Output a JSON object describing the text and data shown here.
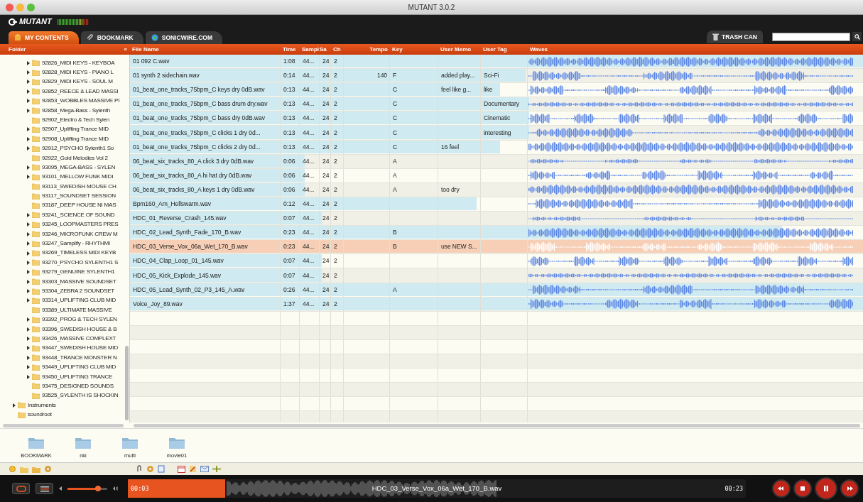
{
  "window": {
    "title": "MUTANT 3.0.2"
  },
  "header": {
    "logo": "MUTANT"
  },
  "tabs": [
    {
      "label": "MY CONTENTS",
      "selected": true
    },
    {
      "label": "BOOKMARK",
      "selected": false
    },
    {
      "label": "SONICWIRE.COM",
      "selected": false
    }
  ],
  "trash_button": "TRASH CAN",
  "folder_panel": {
    "title": "Folder",
    "collapse": "«",
    "tree": [
      {
        "children": [
          {
            "label": "92826_MIDI KEYS - KEYBOA",
            "expandable": true
          },
          {
            "label": "92828_MIDI KEYS - PIANO L",
            "expandable": true
          },
          {
            "label": "92829_MIDI KEYS - SOUL M",
            "expandable": true
          },
          {
            "label": "92852_REECE & LEAD MASSI",
            "expandable": true
          },
          {
            "label": "92853_WOBBLES MASSIVE PI",
            "expandable": true
          },
          {
            "label": "92858_Mega-Bass - Sylenth",
            "expandable": true
          },
          {
            "label": "92902_Electro & Tech Sylen",
            "expandable": false
          },
          {
            "label": "92907_Uplifting Trance MID",
            "expandable": true
          },
          {
            "label": "92908_Uplifting Trance MID",
            "expandable": true
          },
          {
            "label": "92912_PSYCHO Sylenth1 So",
            "expandable": true
          },
          {
            "label": "92922_Gold Melodies Vol 2",
            "expandable": false
          },
          {
            "label": "93095_MEGA-BASS - SYLEN",
            "expandable": true
          },
          {
            "label": "93101_MELLOW FUNK MIDI",
            "expandable": true
          },
          {
            "label": "93113_SWEDISH MOUSE CH",
            "expandable": false
          },
          {
            "label": "93117_SOUNDSET SESSION",
            "expandable": false
          },
          {
            "label": "93187_DEEP HOUSE NI MAS",
            "expandable": false
          },
          {
            "label": "93241_SCIENCE OF SOUND",
            "expandable": true
          },
          {
            "label": "93245_LOOPMASTERS PRES",
            "expandable": true
          },
          {
            "label": "93246_MICROFUNK CREW M",
            "expandable": true
          },
          {
            "label": "93247_Samplify - RHYTHMI",
            "expandable": true
          },
          {
            "label": "93269_TIMELESS MIDI KEYB",
            "expandable": true
          },
          {
            "label": "93270_PSYCHO SYLENTH1 S",
            "expandable": true
          },
          {
            "label": "93279_GENUINE SYLENTH1",
            "expandable": true
          },
          {
            "label": "93303_MASSIVE SOUNDSET",
            "expandable": true
          },
          {
            "label": "93304_ZEBRA 2 SOUNDSET",
            "expandable": true
          },
          {
            "label": "93314_UPLIFTING CLUB MID",
            "expandable": true
          },
          {
            "label": "93389_ULTIMATE MASSIVE",
            "expandable": false
          },
          {
            "label": "93392_PROG & TECH SYLEN",
            "expandable": true
          },
          {
            "label": "93396_SWEDISH HOUSE & B",
            "expandable": true
          },
          {
            "label": "93426_MASSIVE COMPLEXT",
            "expandable": true
          },
          {
            "label": "93447_SWEDISH HOUSE MID",
            "expandable": true
          },
          {
            "label": "93448_TRANCE MONSTER N",
            "expandable": true
          },
          {
            "label": "93449_UPLIFTING CLUB MID",
            "expandable": true
          },
          {
            "label": "93450_UPLIFTING TRANCE",
            "expandable": true
          },
          {
            "label": "93475_DESIGNED SOUNDS",
            "expandable": false
          },
          {
            "label": "93525_SYLENTH IS SHOCKIN",
            "expandable": false
          }
        ]
      },
      {
        "label": "Instruments",
        "expandable": true
      },
      {
        "label": "soundroot",
        "expandable": false
      }
    ]
  },
  "table": {
    "columns": [
      "File Name",
      "Time",
      "Sampl",
      "Sa",
      "Ch",
      "Tempo",
      "Key",
      "User Memo",
      "User Tag",
      "Waves"
    ],
    "rows": [
      {
        "file": "01 092 C.wav",
        "time": "1:08",
        "sample": "44...",
        "bits": "24",
        "ch": "2",
        "level": 1,
        "selected": false
      },
      {
        "file": "01 synth 2 sidechain.wav",
        "time": "0:14",
        "sample": "44...",
        "bits": "24",
        "ch": "2",
        "tempo": "140",
        "key": "F",
        "memo": "added play...",
        "tag": "Sci-Fi",
        "level": 0.54,
        "selected": false
      },
      {
        "file": "01_beat_one_tracks_75bpm_C  keys dry 0dB.wav",
        "time": "0:13",
        "sample": "44...",
        "bits": "24",
        "ch": "2",
        "key": "C",
        "memo": "feel like g...",
        "tag": "like",
        "level": 0.505,
        "selected": false
      },
      {
        "file": "01_beat_one_tracks_75bpm_C bass drum dry.wav",
        "time": "0:13",
        "sample": "44...",
        "bits": "24",
        "ch": "2",
        "key": "C",
        "tag": "Documentary",
        "level": 0.545,
        "selected": false
      },
      {
        "file": "01_beat_one_tracks_75bpm_C bass dry 0dB.wav",
        "time": "0:13",
        "sample": "44...",
        "bits": "24",
        "ch": "2",
        "key": "C",
        "tag": "Cinematic",
        "level": 0.545,
        "selected": false
      },
      {
        "file": "01_beat_one_tracks_75bpm_C clicks 1 dry 0d...",
        "time": "0:13",
        "sample": "44...",
        "bits": "24",
        "ch": "2",
        "key": "C",
        "tag": "interesting",
        "level": 0.545,
        "selected": false
      },
      {
        "file": "01_beat_one_tracks_75bpm_C clicks 2 dry 0d...",
        "time": "0:13",
        "sample": "44...",
        "bits": "24",
        "ch": "2",
        "key": "C",
        "memo": "16 feel",
        "level": 0.505,
        "selected": false
      },
      {
        "file": "06_beat_six_tracks_80_A click 3 dry 0dB.wav",
        "time": "0:06",
        "sample": "44...",
        "bits": "24",
        "ch": "2",
        "key": "A",
        "level": 0.238,
        "selected": false
      },
      {
        "file": "06_beat_six_tracks_80_A hi hat dry 0dB.wav",
        "time": "0:06",
        "sample": "44...",
        "bits": "24",
        "ch": "2",
        "key": "A",
        "level": 0.238,
        "selected": false
      },
      {
        "file": "06_beat_six_tracks_80_A keys 1 dry 0dB.wav",
        "time": "0:06",
        "sample": "44...",
        "bits": "24",
        "ch": "2",
        "key": "A",
        "memo": "too dry",
        "level": 0.238,
        "selected": false
      },
      {
        "file": "Bpm160_Am_Hellswarm.wav",
        "time": "0:12",
        "sample": "44...",
        "bits": "24",
        "ch": "2",
        "level": 0.473,
        "selected": false
      },
      {
        "file": "HDC_01_Reverse_Crash_145.wav",
        "time": "0:07",
        "sample": "44...",
        "bits": "24",
        "ch": "2",
        "level": 0.262,
        "selected": false
      },
      {
        "file": "HDC_02_Lead_Synth_Fade_170_B.wav",
        "time": "0:23",
        "sample": "44...",
        "bits": "24",
        "ch": "2",
        "key": "B",
        "level": 0.89,
        "selected": false
      },
      {
        "file": "HDC_03_Verse_Vox_06a_Wet_170_B.wav",
        "time": "0:23",
        "sample": "44...",
        "bits": "24",
        "ch": "2",
        "key": "B",
        "memo": "use NEW S...",
        "level": 1,
        "selected": true
      },
      {
        "file": "HDC_04_Clap_Loop_01_145.wav",
        "time": "0:07",
        "sample": "44...",
        "bits": "24",
        "ch": "2",
        "level": 0.262,
        "selected": false
      },
      {
        "file": "HDC_05_Kick_Explode_145.wav",
        "time": "0:07",
        "sample": "44...",
        "bits": "24",
        "ch": "2",
        "level": 0.262,
        "selected": false
      },
      {
        "file": "HDC_05_Lead_Synth_02_P3_145_A.wav",
        "time": "0:26",
        "sample": "44...",
        "bits": "24",
        "ch": "2",
        "key": "A",
        "level": 1,
        "selected": false
      },
      {
        "file": "Voice_Joy_89.wav",
        "time": "1:37",
        "sample": "44...",
        "bits": "24",
        "ch": "2",
        "level": 1,
        "selected": false
      }
    ]
  },
  "bookmarks": [
    "BOOKMARK",
    "nki",
    "multi",
    "movie01"
  ],
  "player": {
    "elapsed": "00:03",
    "file": "HDC_03_Verse_Vox_06a_Wet_170_B.wav",
    "duration": "00:23",
    "level": 0.157
  }
}
